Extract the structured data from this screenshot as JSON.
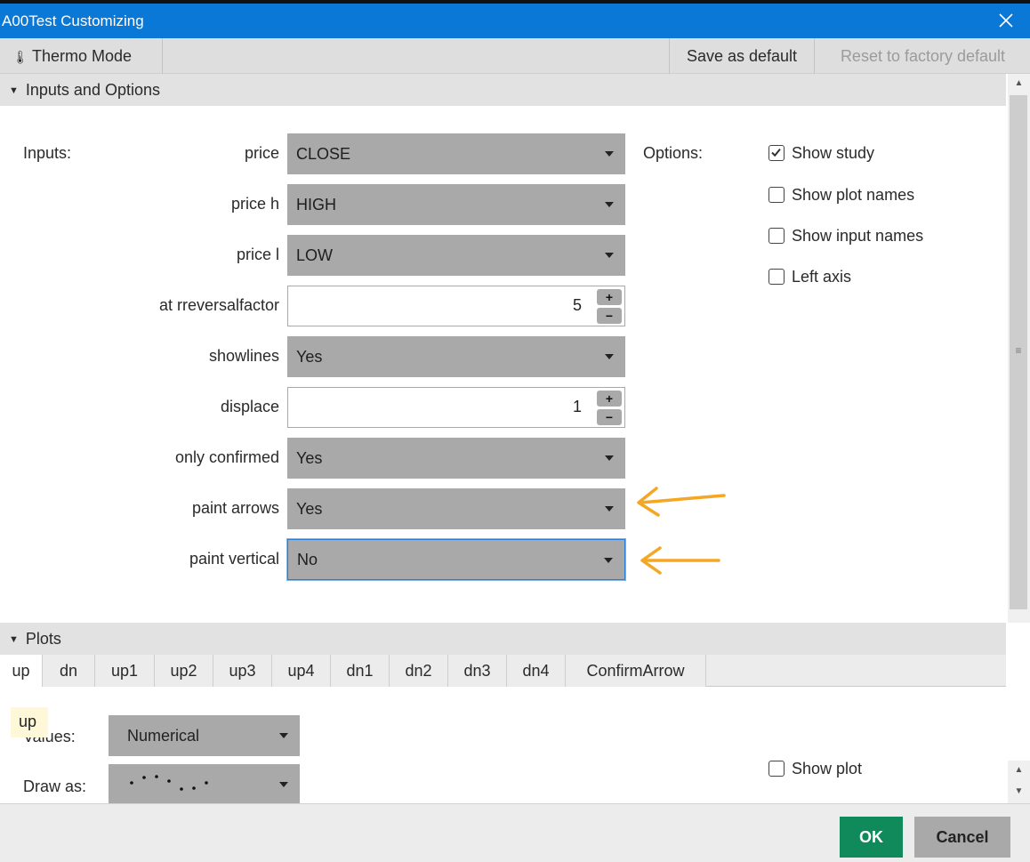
{
  "window": {
    "title": "A00Test Customizing"
  },
  "toolbar": {
    "thermo_label": "Thermo Mode",
    "save_default_label": "Save as default",
    "reset_label": "Reset to factory default"
  },
  "inputs_section": {
    "header": "Inputs and Options",
    "inputs_label": "Inputs:",
    "options_label": "Options:",
    "fields": [
      {
        "label": "price",
        "value": "CLOSE"
      },
      {
        "label": "price h",
        "value": "HIGH"
      },
      {
        "label": "price l",
        "value": "LOW"
      },
      {
        "label": "at rreversalfactor",
        "value": "5"
      },
      {
        "label": "showlines",
        "value": "Yes"
      },
      {
        "label": "displace",
        "value": "1"
      },
      {
        "label": "only confirmed",
        "value": "Yes"
      },
      {
        "label": "paint arrows",
        "value": "Yes"
      },
      {
        "label": "paint vertical",
        "value": "No"
      }
    ],
    "options": [
      {
        "label": "Show study",
        "checked": true
      },
      {
        "label": "Show plot names",
        "checked": false
      },
      {
        "label": "Show input names",
        "checked": false
      },
      {
        "label": "Left axis",
        "checked": false
      }
    ]
  },
  "plots_section": {
    "header": "Plots",
    "tabs": [
      "up",
      "dn",
      "up1",
      "up2",
      "up3",
      "up4",
      "dn1",
      "dn2",
      "dn3",
      "dn4",
      "ConfirmArrow"
    ],
    "tooltip": "up",
    "values_label": "Values:",
    "values_value": "Numerical",
    "draw_as_label": "Draw as:",
    "show_plot_label": "Show plot"
  },
  "footer": {
    "ok_label": "OK",
    "cancel_label": "Cancel"
  },
  "colors": {
    "title_bar": "#0a78d7",
    "ok_button": "#118a5b",
    "annotation_arrow": "#f5a623",
    "focus": "#2a7fd4"
  }
}
